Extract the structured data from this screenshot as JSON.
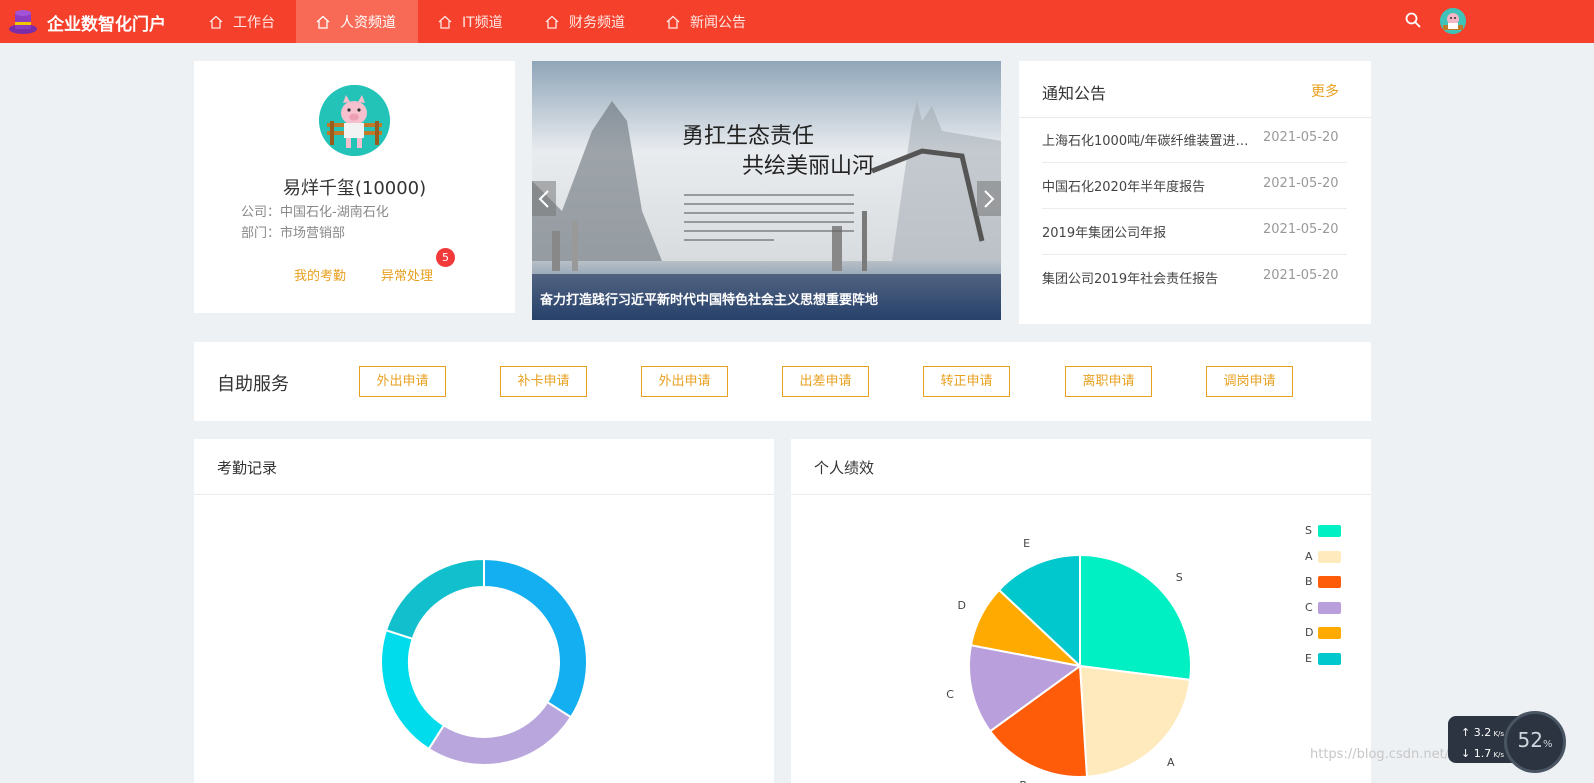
{
  "header": {
    "app_title": "企业数智化门户",
    "nav": [
      {
        "label": "工作台",
        "active": false
      },
      {
        "label": "人资频道",
        "active": true
      },
      {
        "label": "IT频道",
        "active": false
      },
      {
        "label": "财务频道",
        "active": false
      },
      {
        "label": "新闻公告",
        "active": false
      }
    ]
  },
  "profile": {
    "name": "易烊千玺(10000)",
    "company": "公司：中国石化-湖南石化",
    "department": "部门：市场营销部",
    "attendance_link": "我的考勤",
    "exception_link": "异常处理",
    "exception_count": "5"
  },
  "banner": {
    "caption": "奋力打造践行习近平新时代中国特色社会主义思想重要阵地",
    "headline_1": "勇扛生态责任",
    "headline_2": "共绘美丽山河"
  },
  "notices": {
    "title": "通知公告",
    "more_label": "更多",
    "items": [
      {
        "title": "上海石化1000吨/年碳纤维装置进…",
        "date": "2021-05-20"
      },
      {
        "title": "中国石化2020年半年度报告",
        "date": "2021-05-20"
      },
      {
        "title": "2019年集团公司年报",
        "date": "2021-05-20"
      },
      {
        "title": "集团公司2019年社会责任报告",
        "date": "2021-05-20"
      }
    ]
  },
  "self_service": {
    "title": "自助服务",
    "buttons": [
      "外出申请",
      "补卡申请",
      "外出申请",
      "出差申请",
      "转正申请",
      "离职申请",
      "调岗申请"
    ]
  },
  "attendance": {
    "title": "考勤记录"
  },
  "performance": {
    "title": "个人绩效"
  },
  "chart_data": [
    {
      "type": "pie",
      "variant": "donut",
      "slices": [
        {
          "value": 34,
          "color": "#13aff0"
        },
        {
          "value": 25,
          "color": "#b9a6dc"
        },
        {
          "value": 21,
          "color": "#00dcec"
        },
        {
          "value": 20,
          "color": "#11c0cc"
        }
      ]
    },
    {
      "type": "pie",
      "legend_position": "top-right",
      "slices": [
        {
          "name": "S",
          "value": 27,
          "color": "#00f0c4"
        },
        {
          "name": "A",
          "value": 22,
          "color": "#ffeabd"
        },
        {
          "name": "B",
          "value": 16,
          "color": "#ff5c0a"
        },
        {
          "name": "C",
          "value": 13,
          "color": "#b9a0dc"
        },
        {
          "name": "D",
          "value": 9,
          "color": "#ffaa00"
        },
        {
          "name": "E",
          "value": 13,
          "color": "#00c8cc"
        }
      ]
    }
  ],
  "system_overlay": {
    "upload": "3.2",
    "download": "1.7",
    "percent": "52",
    "watermark": "https://blog.csdn.net/luwenjun05101"
  }
}
